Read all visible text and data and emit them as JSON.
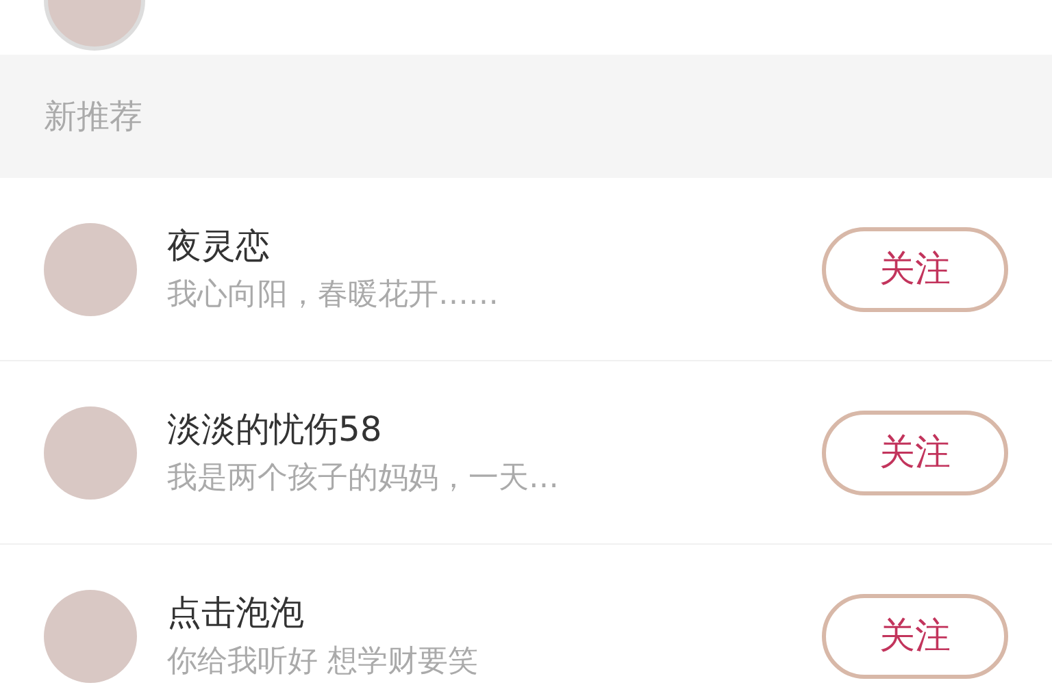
{
  "section": {
    "title": "新推荐"
  },
  "users": [
    {
      "name": "夜灵恋",
      "bio": "我心向阳，春暖花开……",
      "button": "关注"
    },
    {
      "name": "淡淡的忧伤58",
      "bio": "我是两个孩子的妈妈，一天…",
      "button": "关注"
    },
    {
      "name": "点击泡泡",
      "bio": "你给我听好 想学财要笑",
      "button": "关注"
    }
  ]
}
